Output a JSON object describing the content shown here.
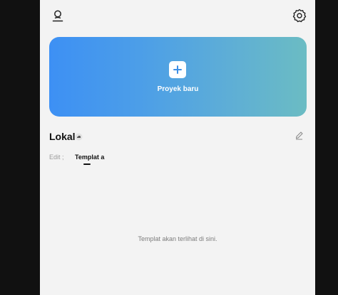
{
  "header": {
    "profile_icon": "person-icon",
    "settings_icon": "gear-icon"
  },
  "new_project": {
    "label": "Proyek baru",
    "icon": "plus-icon",
    "gradient_start": "#3d90f4",
    "gradient_end": "#6bbcc3"
  },
  "section": {
    "title": "Lokal",
    "badge_icon": "cloud-icon",
    "edit_icon": "pencil-icon"
  },
  "tabs": [
    {
      "label": "Edit ;"
    },
    {
      "label": "Templat a"
    }
  ],
  "empty_state": {
    "message": "Templat akan terlihat di sini."
  }
}
